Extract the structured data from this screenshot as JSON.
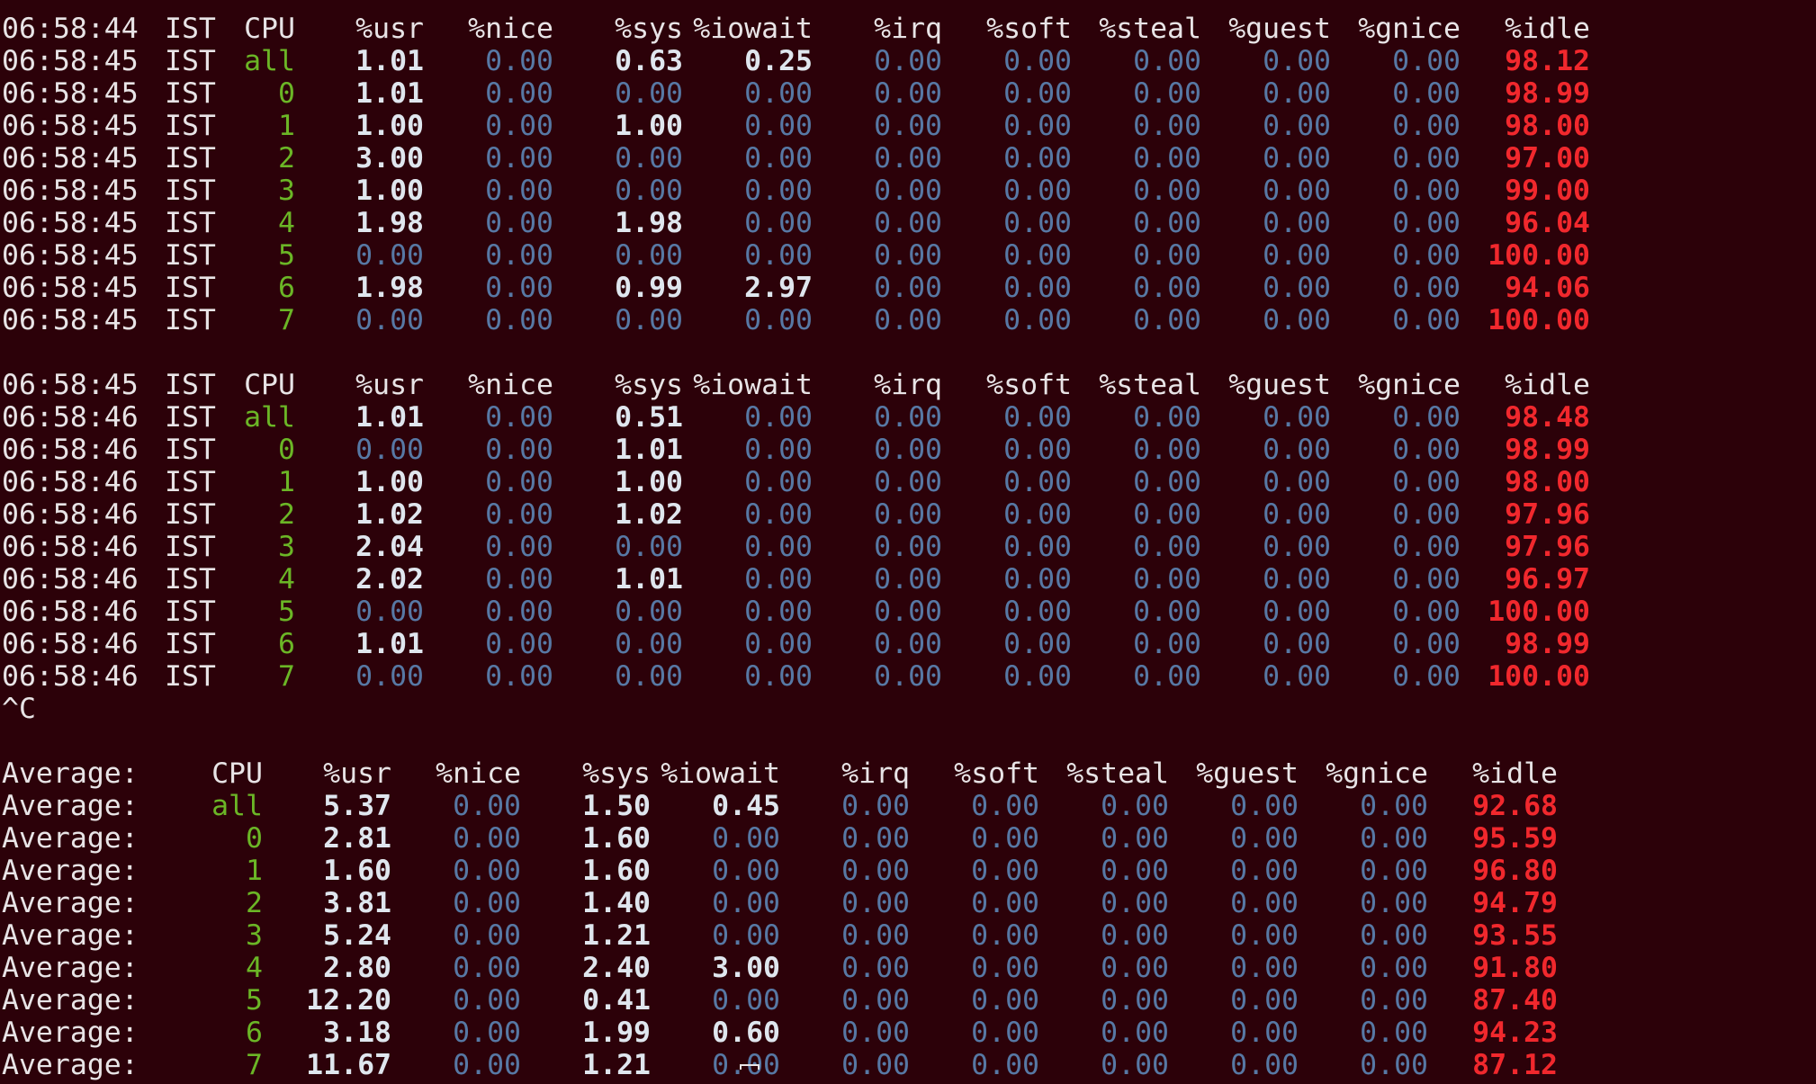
{
  "colors": {
    "background": "#2c0109",
    "text": "#e8e4e6",
    "cpu_id": "#6bb626",
    "zero_value": "#5778a4",
    "nonzero_value": "#dfe6ee",
    "idle_value": "#f1282d"
  },
  "columns": [
    "CPU",
    "%usr",
    "%nice",
    "%sys",
    "%iowait",
    "%irq",
    "%soft",
    "%steal",
    "%guest",
    "%gnice",
    "%idle"
  ],
  "blocks": [
    {
      "header_time": "06:58:44",
      "tz": "IST",
      "rows": [
        {
          "time": "06:58:45",
          "tz": "IST",
          "cpu": "all",
          "v": [
            "1.01",
            "0.00",
            "0.63",
            "0.25",
            "0.00",
            "0.00",
            "0.00",
            "0.00",
            "0.00",
            "98.12"
          ]
        },
        {
          "time": "06:58:45",
          "tz": "IST",
          "cpu": "0",
          "v": [
            "1.01",
            "0.00",
            "0.00",
            "0.00",
            "0.00",
            "0.00",
            "0.00",
            "0.00",
            "0.00",
            "98.99"
          ]
        },
        {
          "time": "06:58:45",
          "tz": "IST",
          "cpu": "1",
          "v": [
            "1.00",
            "0.00",
            "1.00",
            "0.00",
            "0.00",
            "0.00",
            "0.00",
            "0.00",
            "0.00",
            "98.00"
          ]
        },
        {
          "time": "06:58:45",
          "tz": "IST",
          "cpu": "2",
          "v": [
            "3.00",
            "0.00",
            "0.00",
            "0.00",
            "0.00",
            "0.00",
            "0.00",
            "0.00",
            "0.00",
            "97.00"
          ]
        },
        {
          "time": "06:58:45",
          "tz": "IST",
          "cpu": "3",
          "v": [
            "1.00",
            "0.00",
            "0.00",
            "0.00",
            "0.00",
            "0.00",
            "0.00",
            "0.00",
            "0.00",
            "99.00"
          ]
        },
        {
          "time": "06:58:45",
          "tz": "IST",
          "cpu": "4",
          "v": [
            "1.98",
            "0.00",
            "1.98",
            "0.00",
            "0.00",
            "0.00",
            "0.00",
            "0.00",
            "0.00",
            "96.04"
          ]
        },
        {
          "time": "06:58:45",
          "tz": "IST",
          "cpu": "5",
          "v": [
            "0.00",
            "0.00",
            "0.00",
            "0.00",
            "0.00",
            "0.00",
            "0.00",
            "0.00",
            "0.00",
            "100.00"
          ]
        },
        {
          "time": "06:58:45",
          "tz": "IST",
          "cpu": "6",
          "v": [
            "1.98",
            "0.00",
            "0.99",
            "2.97",
            "0.00",
            "0.00",
            "0.00",
            "0.00",
            "0.00",
            "94.06"
          ]
        },
        {
          "time": "06:58:45",
          "tz": "IST",
          "cpu": "7",
          "v": [
            "0.00",
            "0.00",
            "0.00",
            "0.00",
            "0.00",
            "0.00",
            "0.00",
            "0.00",
            "0.00",
            "100.00"
          ]
        }
      ]
    },
    {
      "header_time": "06:58:45",
      "tz": "IST",
      "rows": [
        {
          "time": "06:58:46",
          "tz": "IST",
          "cpu": "all",
          "v": [
            "1.01",
            "0.00",
            "0.51",
            "0.00",
            "0.00",
            "0.00",
            "0.00",
            "0.00",
            "0.00",
            "98.48"
          ]
        },
        {
          "time": "06:58:46",
          "tz": "IST",
          "cpu": "0",
          "v": [
            "0.00",
            "0.00",
            "1.01",
            "0.00",
            "0.00",
            "0.00",
            "0.00",
            "0.00",
            "0.00",
            "98.99"
          ]
        },
        {
          "time": "06:58:46",
          "tz": "IST",
          "cpu": "1",
          "v": [
            "1.00",
            "0.00",
            "1.00",
            "0.00",
            "0.00",
            "0.00",
            "0.00",
            "0.00",
            "0.00",
            "98.00"
          ]
        },
        {
          "time": "06:58:46",
          "tz": "IST",
          "cpu": "2",
          "v": [
            "1.02",
            "0.00",
            "1.02",
            "0.00",
            "0.00",
            "0.00",
            "0.00",
            "0.00",
            "0.00",
            "97.96"
          ]
        },
        {
          "time": "06:58:46",
          "tz": "IST",
          "cpu": "3",
          "v": [
            "2.04",
            "0.00",
            "0.00",
            "0.00",
            "0.00",
            "0.00",
            "0.00",
            "0.00",
            "0.00",
            "97.96"
          ]
        },
        {
          "time": "06:58:46",
          "tz": "IST",
          "cpu": "4",
          "v": [
            "2.02",
            "0.00",
            "1.01",
            "0.00",
            "0.00",
            "0.00",
            "0.00",
            "0.00",
            "0.00",
            "96.97"
          ]
        },
        {
          "time": "06:58:46",
          "tz": "IST",
          "cpu": "5",
          "v": [
            "0.00",
            "0.00",
            "0.00",
            "0.00",
            "0.00",
            "0.00",
            "0.00",
            "0.00",
            "0.00",
            "100.00"
          ]
        },
        {
          "time": "06:58:46",
          "tz": "IST",
          "cpu": "6",
          "v": [
            "1.01",
            "0.00",
            "0.00",
            "0.00",
            "0.00",
            "0.00",
            "0.00",
            "0.00",
            "0.00",
            "98.99"
          ]
        },
        {
          "time": "06:58:46",
          "tz": "IST",
          "cpu": "7",
          "v": [
            "0.00",
            "0.00",
            "0.00",
            "0.00",
            "0.00",
            "0.00",
            "0.00",
            "0.00",
            "0.00",
            "100.00"
          ]
        }
      ]
    }
  ],
  "interrupt_text": "^C",
  "average": {
    "label": "Average:",
    "rows": [
      {
        "cpu": "all",
        "v": [
          "5.37",
          "0.00",
          "1.50",
          "0.45",
          "0.00",
          "0.00",
          "0.00",
          "0.00",
          "0.00",
          "92.68"
        ]
      },
      {
        "cpu": "0",
        "v": [
          "2.81",
          "0.00",
          "1.60",
          "0.00",
          "0.00",
          "0.00",
          "0.00",
          "0.00",
          "0.00",
          "95.59"
        ]
      },
      {
        "cpu": "1",
        "v": [
          "1.60",
          "0.00",
          "1.60",
          "0.00",
          "0.00",
          "0.00",
          "0.00",
          "0.00",
          "0.00",
          "96.80"
        ]
      },
      {
        "cpu": "2",
        "v": [
          "3.81",
          "0.00",
          "1.40",
          "0.00",
          "0.00",
          "0.00",
          "0.00",
          "0.00",
          "0.00",
          "94.79"
        ]
      },
      {
        "cpu": "3",
        "v": [
          "5.24",
          "0.00",
          "1.21",
          "0.00",
          "0.00",
          "0.00",
          "0.00",
          "0.00",
          "0.00",
          "93.55"
        ]
      },
      {
        "cpu": "4",
        "v": [
          "2.80",
          "0.00",
          "2.40",
          "3.00",
          "0.00",
          "0.00",
          "0.00",
          "0.00",
          "0.00",
          "91.80"
        ]
      },
      {
        "cpu": "5",
        "v": [
          "12.20",
          "0.00",
          "0.41",
          "0.00",
          "0.00",
          "0.00",
          "0.00",
          "0.00",
          "0.00",
          "87.40"
        ]
      },
      {
        "cpu": "6",
        "v": [
          "3.18",
          "0.00",
          "1.99",
          "0.60",
          "0.00",
          "0.00",
          "0.00",
          "0.00",
          "0.00",
          "94.23"
        ]
      },
      {
        "cpu": "7",
        "v": [
          "11.67",
          "0.00",
          "1.21",
          "0.00",
          "0.00",
          "0.00",
          "0.00",
          "0.00",
          "0.00",
          "87.12"
        ]
      }
    ]
  }
}
